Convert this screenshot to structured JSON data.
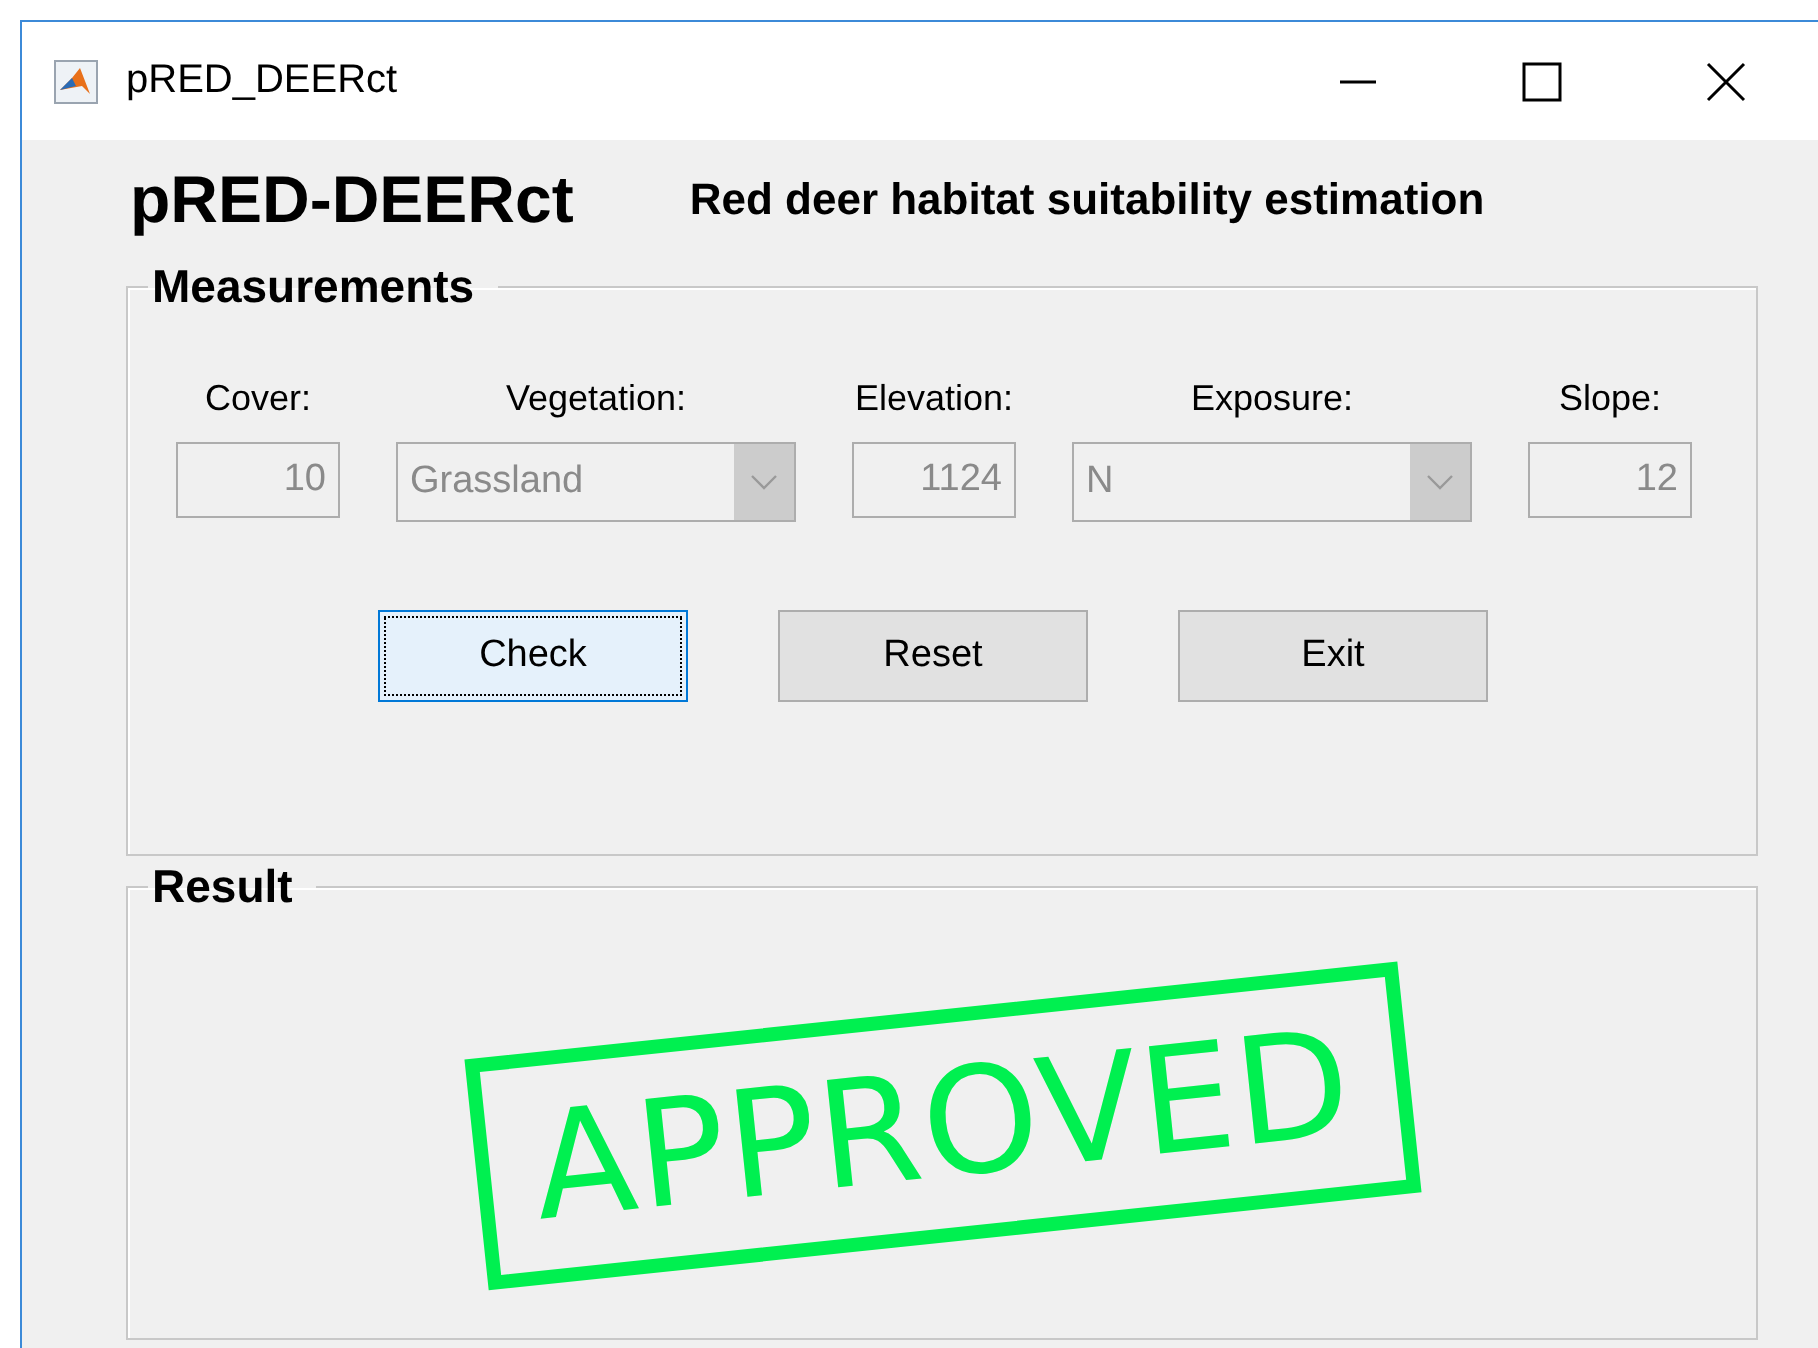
{
  "window": {
    "title": "pRED_DEERct"
  },
  "header": {
    "app_name": "pRED-DEERct",
    "subtitle": "Red deer habitat suitability estimation"
  },
  "measurements": {
    "title": "Measurements",
    "fields": [
      {
        "kind": "text",
        "label": "Cover:",
        "value": "10",
        "disabled": true
      },
      {
        "kind": "dropdown",
        "label": "Vegetation:",
        "value": "Grassland",
        "disabled": true
      },
      {
        "kind": "text",
        "label": "Elevation:",
        "value": "1124",
        "disabled": true
      },
      {
        "kind": "dropdown",
        "label": "Exposure:",
        "value": "N",
        "disabled": true
      },
      {
        "kind": "text",
        "label": "Slope:",
        "value": "12",
        "disabled": true
      }
    ],
    "buttons": [
      {
        "label": "Check",
        "focused": true
      },
      {
        "label": "Reset",
        "focused": false
      },
      {
        "label": "Exit",
        "focused": false
      }
    ]
  },
  "result": {
    "title": "Result",
    "stamp": "APPROVED"
  }
}
